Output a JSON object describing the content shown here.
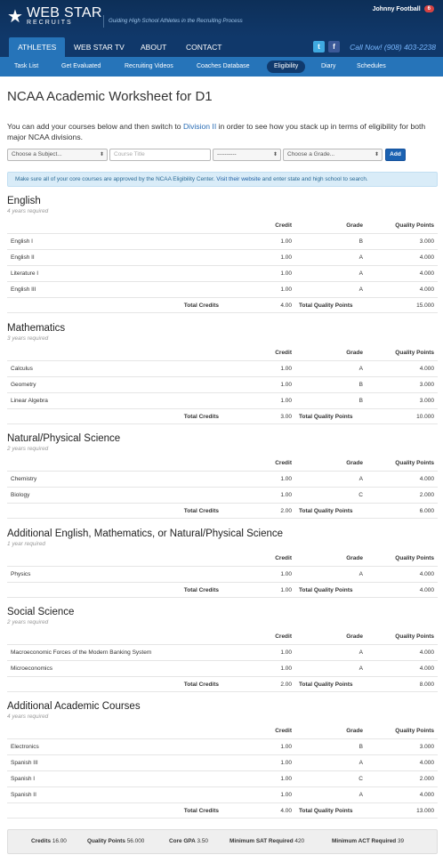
{
  "header": {
    "logo_main": "WEB STAR",
    "logo_sub": "RECRUITS",
    "tagline": "Guiding High School Athletes in the Recruiting Process",
    "user_name": "Johnny Football",
    "notifications": "6",
    "phone": "Call Now! (908) 403-2238"
  },
  "main_nav": [
    "ATHLETES",
    "WEB STAR TV",
    "ABOUT",
    "CONTACT"
  ],
  "sub_nav": [
    "Task List",
    "Get Evaluated",
    "Recruiting Videos",
    "Coaches Database",
    "Eligibility",
    "Diary",
    "Schedules"
  ],
  "page": {
    "title": "NCAA Academic Worksheet for D1",
    "intro_before": "You can add your courses below and then switch to ",
    "intro_link": "Division II",
    "intro_after": " in order to see how you stack up in terms of eligibility for both major NCAA divisions."
  },
  "controls": {
    "subject": "Choose a Subject...",
    "course_placeholder": "Course Title",
    "level": "----------",
    "grade": "Choose a Grade...",
    "add": "Add"
  },
  "notice": {
    "before": "Make sure all of your core courses are approved by the NCAA Eligibility Center. ",
    "link": "Visit their website",
    "after": " and enter state and high school to search."
  },
  "columns": {
    "credit": "Credit",
    "grade": "Grade",
    "quality": "Quality Points",
    "total_credits": "Total Credits",
    "total_quality": "Total Quality Points"
  },
  "sections": [
    {
      "title": "English",
      "req": "4 years required",
      "rows": [
        {
          "name": "English I",
          "credit": "1.00",
          "grade": "B",
          "qp": "3.000"
        },
        {
          "name": "English II",
          "credit": "1.00",
          "grade": "A",
          "qp": "4.000"
        },
        {
          "name": "Literature I",
          "credit": "1.00",
          "grade": "A",
          "qp": "4.000"
        },
        {
          "name": "English III",
          "credit": "1.00",
          "grade": "A",
          "qp": "4.000"
        }
      ],
      "total_credits": "4.00",
      "total_qp": "15.000"
    },
    {
      "title": "Mathematics",
      "req": "3 years required",
      "rows": [
        {
          "name": "Calculus",
          "credit": "1.00",
          "grade": "A",
          "qp": "4.000"
        },
        {
          "name": "Geometry",
          "credit": "1.00",
          "grade": "B",
          "qp": "3.000"
        },
        {
          "name": "Linear Algebra",
          "credit": "1.00",
          "grade": "B",
          "qp": "3.000"
        }
      ],
      "total_credits": "3.00",
      "total_qp": "10.000"
    },
    {
      "title": "Natural/Physical Science",
      "req": "2 years required",
      "rows": [
        {
          "name": "Chemistry",
          "credit": "1.00",
          "grade": "A",
          "qp": "4.000"
        },
        {
          "name": "Biology",
          "credit": "1.00",
          "grade": "C",
          "qp": "2.000"
        }
      ],
      "total_credits": "2.00",
      "total_qp": "6.000"
    },
    {
      "title": "Additional English, Mathematics, or Natural/Physical Science",
      "req": "1 year required",
      "rows": [
        {
          "name": "Physics",
          "credit": "1.00",
          "grade": "A",
          "qp": "4.000"
        }
      ],
      "total_credits": "1.00",
      "total_qp": "4.000"
    },
    {
      "title": "Social Science",
      "req": "2 years required",
      "rows": [
        {
          "name": "Macroeconomic Forces of the Modern Banking System",
          "credit": "1.00",
          "grade": "A",
          "qp": "4.000"
        },
        {
          "name": "Microeconomics",
          "credit": "1.00",
          "grade": "A",
          "qp": "4.000"
        }
      ],
      "total_credits": "2.00",
      "total_qp": "8.000"
    },
    {
      "title": "Additional Academic Courses",
      "req": "4 years required",
      "rows": [
        {
          "name": "Electronics",
          "credit": "1.00",
          "grade": "B",
          "qp": "3.000"
        },
        {
          "name": "Spanish III",
          "credit": "1.00",
          "grade": "A",
          "qp": "4.000"
        },
        {
          "name": "Spanish I",
          "credit": "1.00",
          "grade": "C",
          "qp": "2.000"
        },
        {
          "name": "Spanish II",
          "credit": "1.00",
          "grade": "A",
          "qp": "4.000"
        }
      ],
      "total_credits": "4.00",
      "total_qp": "13.000"
    }
  ],
  "summary": {
    "credits_label": "Credits",
    "credits": "16.00",
    "qp_label": "Quality Points",
    "qp": "56.000",
    "gpa_label": "Core GPA",
    "gpa": "3.50",
    "sat_label": "Minimum SAT Required",
    "sat": "420",
    "act_label": "Minimum ACT Required",
    "act": "39"
  }
}
